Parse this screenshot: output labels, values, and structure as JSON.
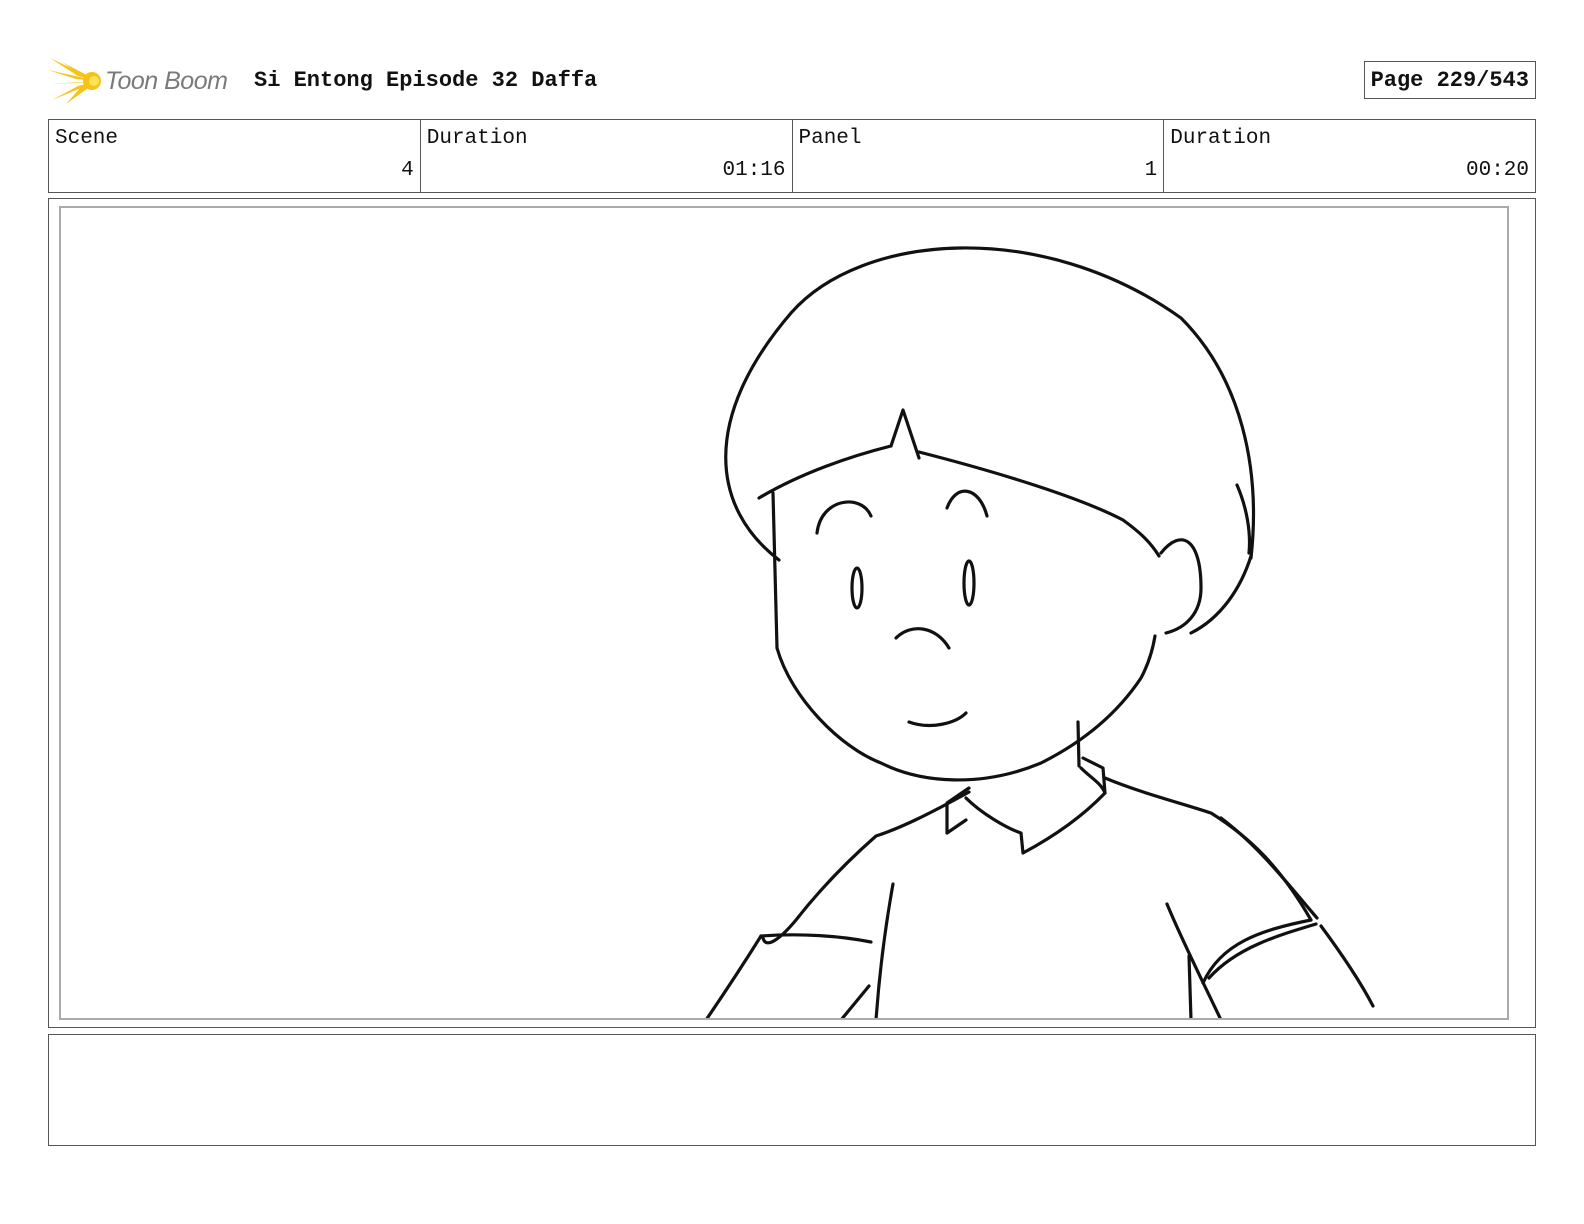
{
  "header": {
    "logo_text": "Toon Boom",
    "title": "Si Entong Episode 32 Daffa",
    "page_label": "Page 229/543"
  },
  "info": {
    "scene_label": "Scene",
    "scene_value": "4",
    "scene_duration_label": "Duration",
    "scene_duration_value": "01:16",
    "panel_label": "Panel",
    "panel_value": "1",
    "panel_duration_label": "Duration",
    "panel_duration_value": "00:20"
  },
  "notes": {
    "text": ""
  }
}
